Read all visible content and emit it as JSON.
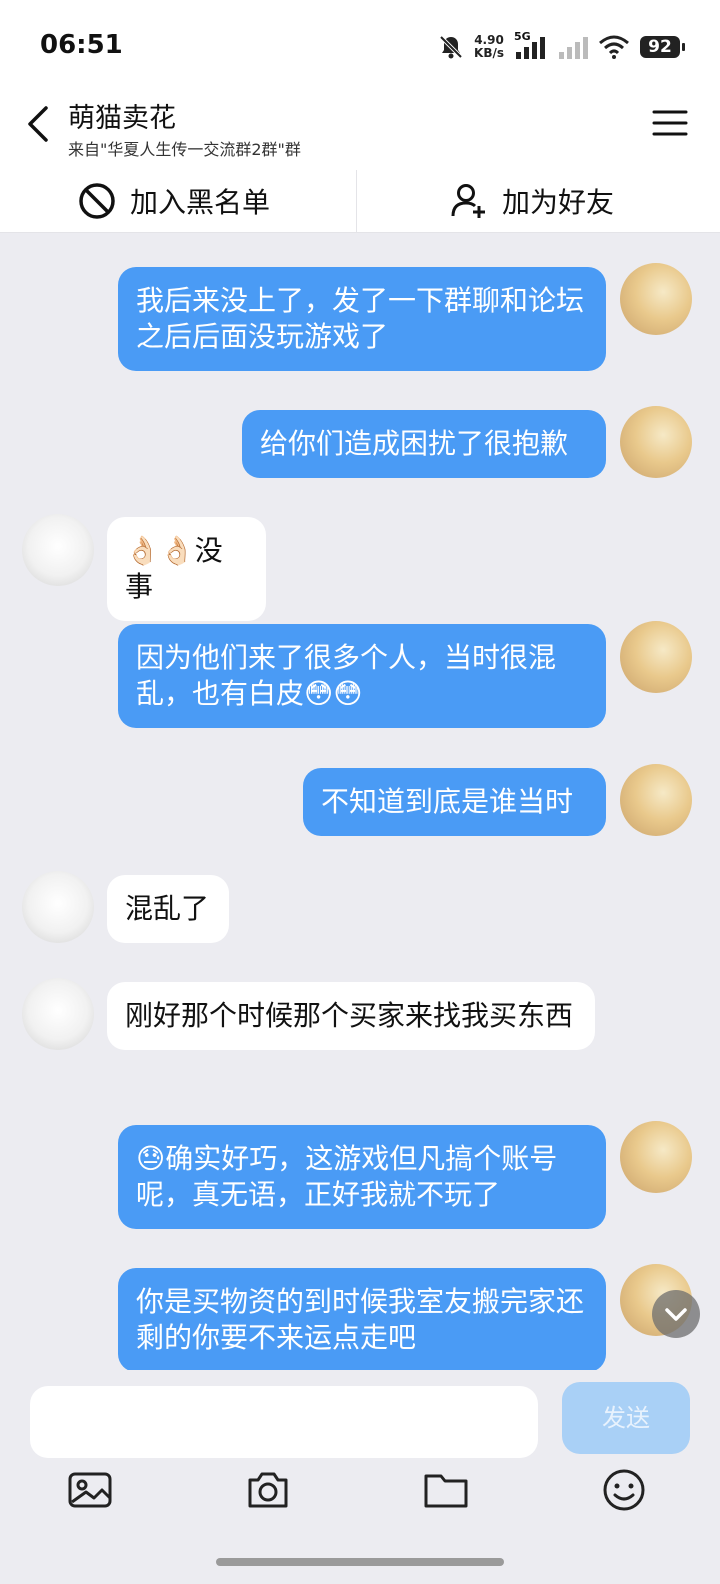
{
  "status_bar": {
    "time": "06:51",
    "net_speed_value": "4.90",
    "net_speed_unit": "KB/s",
    "network_type": "5G",
    "battery": "92"
  },
  "header": {
    "title": "萌猫卖花",
    "subtitle": "来自\"华夏人生传一交流群2群\"群"
  },
  "actions": {
    "block": "加入黑名单",
    "add_friend": "加为好友"
  },
  "messages": [
    {
      "from": "me",
      "text": "我后来没上了，发了一下群聊和论坛之后后面没玩游戏了"
    },
    {
      "from": "me",
      "text": "给你们造成困扰了很抱歉"
    },
    {
      "from": "other",
      "text": "👌🏻👌🏻没事"
    },
    {
      "from": "me",
      "text": "因为他们来了很多个人，当时很混乱，也有白皮😳😳"
    },
    {
      "from": "me",
      "text": "不知道到底是谁当时"
    },
    {
      "from": "other",
      "text": "混乱了"
    },
    {
      "from": "other",
      "text": "刚好那个时候那个买家来找我买东西"
    },
    {
      "from": "me",
      "text": "😓确实好巧，这游戏但凡搞个账号呢，真无语，正好我就不玩了"
    },
    {
      "from": "me",
      "text": "你是买物资的到时候我室友搬完家还剩的你要不来运点走吧"
    }
  ],
  "composer": {
    "input_value": "",
    "send_label": "发送",
    "tools": [
      "image-icon",
      "camera-icon",
      "folder-icon",
      "emoji-icon"
    ]
  },
  "colors": {
    "outgoing_bubble": "#4a9bf5",
    "incoming_bubble": "#ffffff",
    "background": "#ececf1",
    "send_disabled": "#a9d0f6"
  }
}
